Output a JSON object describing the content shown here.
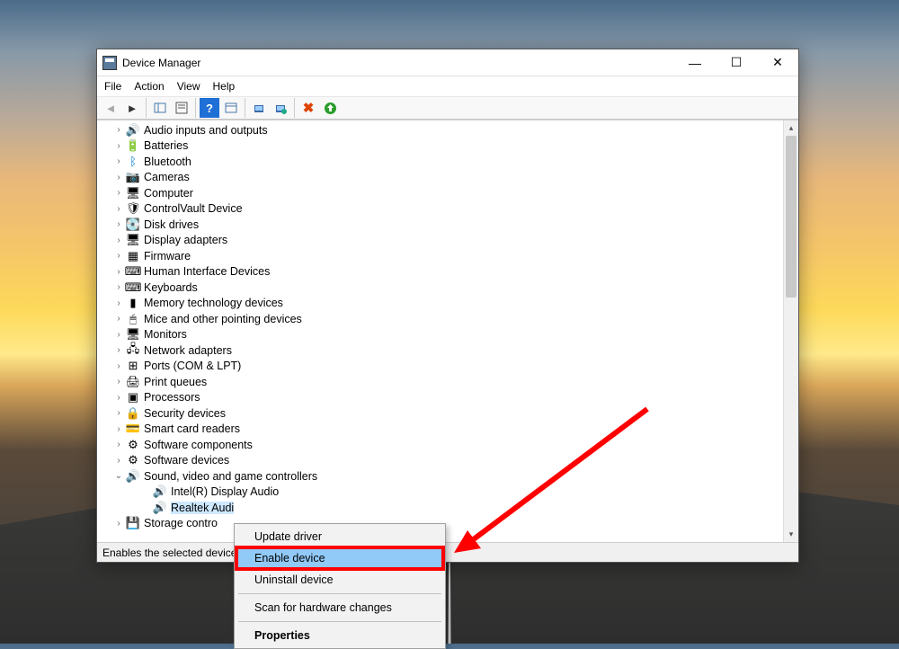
{
  "window": {
    "title": "Device Manager",
    "menus": [
      "File",
      "Action",
      "View",
      "Help"
    ],
    "status": "Enables the selected device."
  },
  "toolbar": {
    "back": "←",
    "fwd": "→",
    "sep": "|",
    "t1": "▭",
    "t2": "▭",
    "t3": "?",
    "t4": "▦",
    "t5": "🖥",
    "t6": "🖥",
    "t7": "✖",
    "t8": "⬆"
  },
  "tree": [
    {
      "icon": "🔊",
      "label": "Audio inputs and outputs"
    },
    {
      "icon": "🔋",
      "label": "Batteries"
    },
    {
      "icon": "ᛒ",
      "label": "Bluetooth",
      "iconColor": "#0078d7"
    },
    {
      "icon": "📷",
      "label": "Cameras"
    },
    {
      "icon": "🖥",
      "label": "Computer"
    },
    {
      "icon": "🛡",
      "label": "ControlVault Device"
    },
    {
      "icon": "💽",
      "label": "Disk drives"
    },
    {
      "icon": "🖥",
      "label": "Display adapters"
    },
    {
      "icon": "▦",
      "label": "Firmware"
    },
    {
      "icon": "⌨",
      "label": "Human Interface Devices"
    },
    {
      "icon": "⌨",
      "label": "Keyboards"
    },
    {
      "icon": "▮",
      "label": "Memory technology devices"
    },
    {
      "icon": "🖱",
      "label": "Mice and other pointing devices"
    },
    {
      "icon": "🖥",
      "label": "Monitors"
    },
    {
      "icon": "🖧",
      "label": "Network adapters"
    },
    {
      "icon": "⊞",
      "label": "Ports (COM & LPT)"
    },
    {
      "icon": "🖨",
      "label": "Print queues"
    },
    {
      "icon": "▣",
      "label": "Processors"
    },
    {
      "icon": "🔒",
      "label": "Security devices"
    },
    {
      "icon": "💳",
      "label": "Smart card readers"
    },
    {
      "icon": "⚙",
      "label": "Software components"
    },
    {
      "icon": "⚙",
      "label": "Software devices"
    },
    {
      "icon": "🔊",
      "label": "Sound, video and game controllers",
      "expanded": true,
      "children": [
        {
          "icon": "🔊",
          "label": "Intel(R) Display Audio"
        },
        {
          "icon": "🔊",
          "label": "Realtek Audi",
          "selected": true
        }
      ]
    },
    {
      "icon": "💾",
      "label": "Storage contro"
    }
  ],
  "contextMenu": {
    "items": [
      {
        "label": "Update driver"
      },
      {
        "label": "Enable device",
        "highlighted": true
      },
      {
        "label": "Uninstall device"
      },
      {
        "sep": true
      },
      {
        "label": "Scan for hardware changes"
      },
      {
        "sep": true
      },
      {
        "label": "Properties",
        "bold": true
      }
    ]
  }
}
